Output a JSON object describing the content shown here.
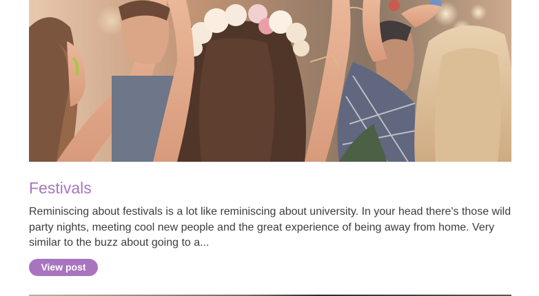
{
  "post": {
    "image_description_icon": "festival-crowd-photo",
    "title": "Festivals",
    "excerpt": "Reminiscing about festivals is a lot like reminiscing about university. In your head there's those wild party nights, meeting cool new people and the great experience of being away from home. Very similar to the buzz about going to a...",
    "button_label": "View post"
  },
  "colors": {
    "accent": "#a874bf",
    "text": "#3c3c3c",
    "background": "#ffffff"
  }
}
